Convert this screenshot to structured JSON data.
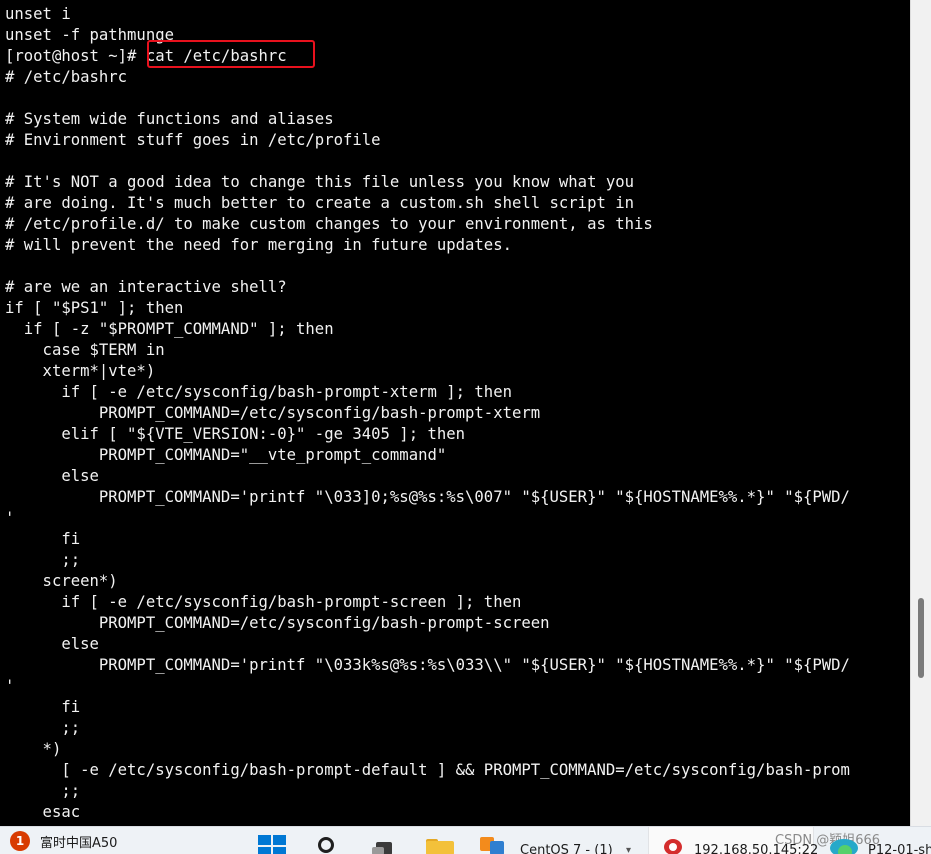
{
  "terminal": {
    "lines": [
      "unset i",
      "unset -f pathmunge",
      "[root@host ~]# cat /etc/bashrc",
      "# /etc/bashrc",
      "",
      "# System wide functions and aliases",
      "# Environment stuff goes in /etc/profile",
      "",
      "# It's NOT a good idea to change this file unless you know what you",
      "# are doing. It's much better to create a custom.sh shell script in",
      "# /etc/profile.d/ to make custom changes to your environment, as this",
      "# will prevent the need for merging in future updates.",
      "",
      "# are we an interactive shell?",
      "if [ \"$PS1\" ]; then",
      "  if [ -z \"$PROMPT_COMMAND\" ]; then",
      "    case $TERM in",
      "    xterm*|vte*)",
      "      if [ -e /etc/sysconfig/bash-prompt-xterm ]; then",
      "          PROMPT_COMMAND=/etc/sysconfig/bash-prompt-xterm",
      "      elif [ \"${VTE_VERSION:-0}\" -ge 3405 ]; then",
      "          PROMPT_COMMAND=\"__vte_prompt_command\"",
      "      else",
      "          PROMPT_COMMAND='printf \"\\033]0;%s@%s:%s\\007\" \"${USER}\" \"${HOSTNAME%%.*}\" \"${PWD/",
      "'",
      "      fi",
      "      ;;",
      "    screen*)",
      "      if [ -e /etc/sysconfig/bash-prompt-screen ]; then",
      "          PROMPT_COMMAND=/etc/sysconfig/bash-prompt-screen",
      "      else",
      "          PROMPT_COMMAND='printf \"\\033k%s@%s:%s\\033\\\\\" \"${USER}\" \"${HOSTNAME%%.*}\" \"${PWD/",
      "'",
      "      fi",
      "      ;;",
      "    *)",
      "      [ -e /etc/sysconfig/bash-prompt-default ] && PROMPT_COMMAND=/etc/sysconfig/bash-prom",
      "      ;;",
      "    esac"
    ],
    "highlight_color": "#e8111d"
  },
  "taskbar": {
    "weather_badge": "1",
    "weather_text": "富时中国A50",
    "icons": [
      "windows-start-icon",
      "search-icon",
      "task-view-icon",
      "file-explorer-icon",
      "vmware-icon",
      "xshell-icon",
      "edge-icon"
    ],
    "centos_label": "CentOS 7 - (1)",
    "ssh_label": "192.168.50.145:22",
    "watermark": "CSDN @颖姐666",
    "last_label": "P12-01-sh"
  },
  "colors": {
    "terminal_bg": "#000000",
    "terminal_fg": "#f2f2f2",
    "scrollbar_bg": "#f1f1f1",
    "taskbar_bg": "#eef2f6"
  }
}
